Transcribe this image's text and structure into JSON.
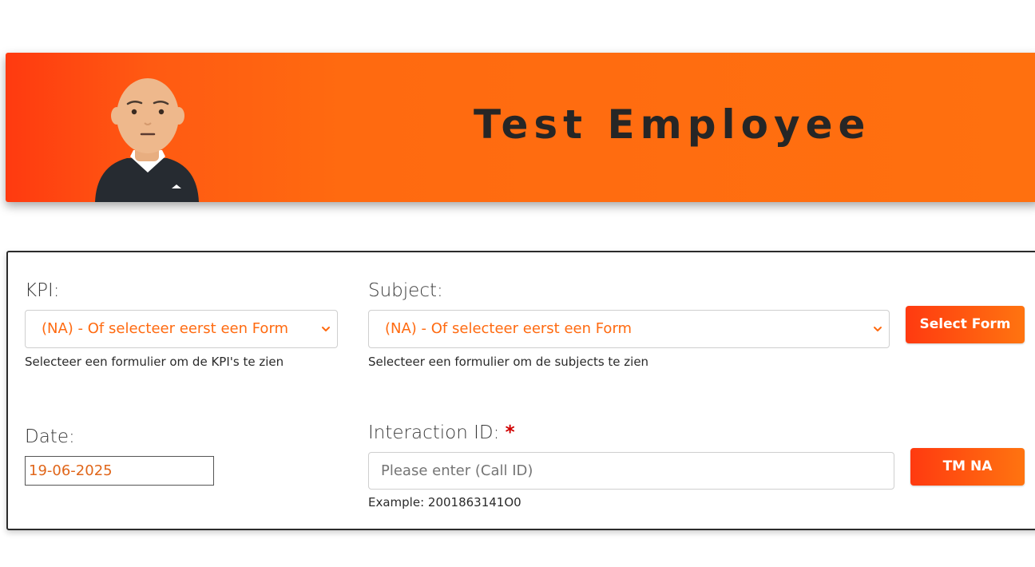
{
  "header": {
    "title": "Test Employee"
  },
  "form": {
    "kpi": {
      "label": "KPI:",
      "selected": "(NA) - Of selecteer eerst een Form",
      "help": "Selecteer een formulier om de KPI's te zien"
    },
    "subject": {
      "label": "Subject:",
      "selected": "(NA) - Of selecteer eerst een Form",
      "help": "Selecteer een formulier om de subjects te zien"
    },
    "select_form_button": "Select Form",
    "date": {
      "label": "Date:",
      "value": "19-06-2025"
    },
    "interaction_id": {
      "label": "Interaction ID:",
      "required_marker": "*",
      "placeholder": "Please enter (Call ID)",
      "value": "",
      "example": "Example: 2001863141O0"
    },
    "tm_na_button": "TM NA"
  },
  "colors": {
    "accent_orange": "#ff6a10",
    "accent_red": "#ff3a10",
    "required": "#d00000"
  },
  "icons": {
    "dropdown": "chevron-down-icon",
    "avatar": "employee-avatar"
  }
}
